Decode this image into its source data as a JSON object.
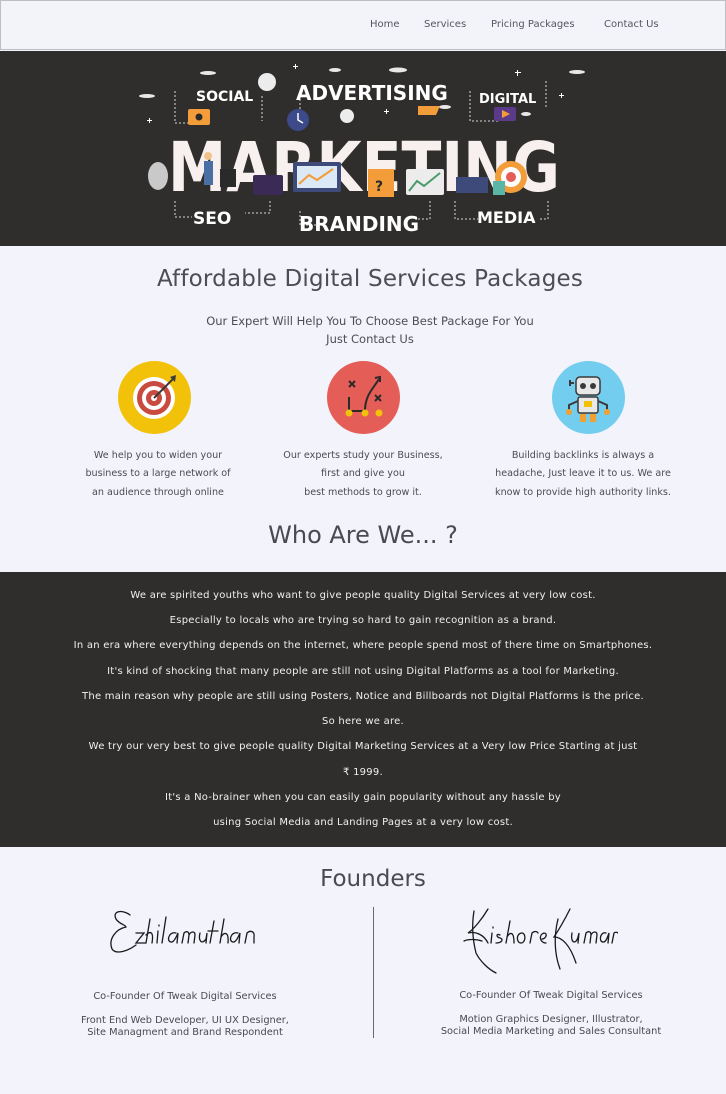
{
  "nav": {
    "items": [
      "Home",
      "Services",
      "Pricing Packages",
      "Contact Us"
    ]
  },
  "hero": {
    "words": {
      "social": "SOCIAL",
      "advertising": "ADVERTISING",
      "digital": "DIGITAL",
      "marketing": "MARKETING",
      "seo": "SEO",
      "branding": "BRANDING",
      "media": "MEDIA"
    }
  },
  "packages": {
    "title": "Affordable Digital Services Packages",
    "subtitle_line1": "Our Expert Will Help You To Choose Best Package For You",
    "subtitle_line2": "Just Contact Us",
    "features": [
      {
        "icon": "target-icon",
        "lines": [
          "We help you to widen your",
          "business to a large network of",
          "an audience through online"
        ]
      },
      {
        "icon": "strategy-icon",
        "lines": [
          "Our experts study your Business,",
          "first and give you",
          "best methods to grow it."
        ]
      },
      {
        "icon": "robot-icon",
        "lines": [
          "Building backlinks is always a",
          "headache, Just leave it to us. We are",
          "know to provide high authority links."
        ]
      }
    ]
  },
  "who": {
    "title": "Who Are We... ?",
    "lines": [
      "We are spirited youths who want to give people quality Digital Services at very low cost.",
      "Especially to locals who are trying so hard to gain recognition as a brand.",
      "In an era where everything depends on the internet, where people spend most of there time on Smartphones.",
      "It's kind of shocking that many people are still not using Digital Platforms as a tool for Marketing.",
      "The main reason why people are still using Posters, Notice and Billboards not Digital Platforms is the price.",
      "So here we are.",
      "We try our very best to give people quality Digital Marketing Services at a Very low Price Starting at just",
      "₹ 1999.",
      "It's a No-brainer when you can easily gain popularity without any hassle by",
      "using Social Media and Landing Pages at a very low cost."
    ]
  },
  "founders": {
    "title": "Founders",
    "people": [
      {
        "signature": "Ezhilamuthan",
        "role": "Co-Founder Of Tweak Digital Services",
        "desc_line1": "Front End Web Developer, UI UX Designer,",
        "desc_line2": "Site Managment and Brand Respondent"
      },
      {
        "signature": "Kishore Kumar",
        "role": "Co-Founder Of Tweak Digital Services",
        "desc_line1": "Motion Graphics Designer, Illustrator,",
        "desc_line2": "Social Media Marketing and Sales Consultant"
      }
    ]
  },
  "colors": {
    "dark_band": "#2f2e2c",
    "page_bg": "#f2f3fb",
    "icon_yellow": "#f2c20b",
    "icon_red": "#e55d57",
    "icon_blue": "#73cdee",
    "accent_orange": "#f0a030"
  }
}
